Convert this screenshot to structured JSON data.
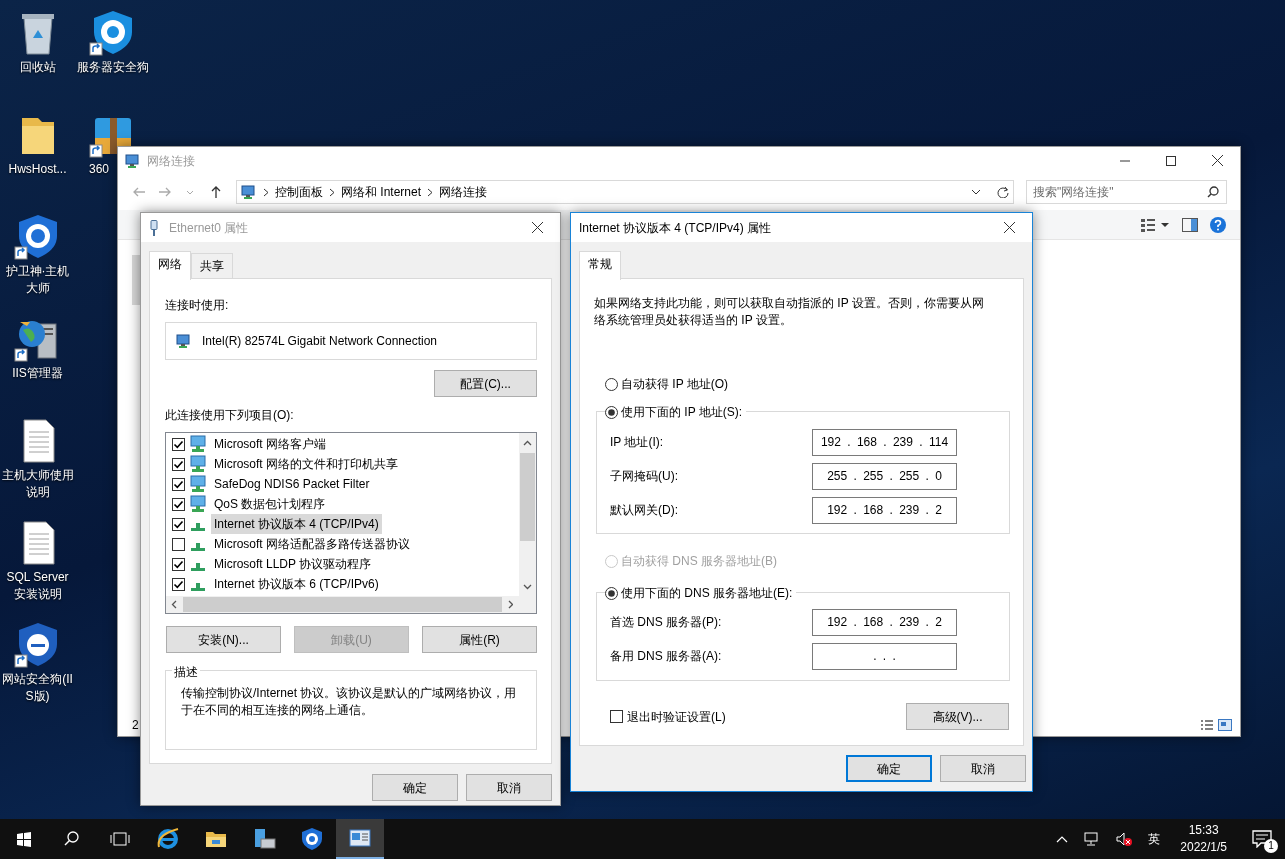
{
  "desktop_icons": [
    {
      "label": "回收站",
      "kind": "recycle",
      "shortcut": false
    },
    {
      "label": "HwsHost...",
      "kind": "folder",
      "shortcut": false
    },
    {
      "label": "护卫神·主机大师",
      "kind": "shield_w",
      "shortcut": true
    },
    {
      "label": "IIS管理器",
      "kind": "iis",
      "shortcut": true
    },
    {
      "label": "主机大师使用说明",
      "kind": "document",
      "shortcut": false
    },
    {
      "label": "SQL Server 安装说明",
      "kind": "document",
      "shortcut": false
    },
    {
      "label": "网站安全狗(IIS版)",
      "kind": "shield_e",
      "shortcut": true
    },
    {
      "label": "服务器安全狗",
      "kind": "shield_s",
      "shortcut": true
    },
    {
      "label": "360",
      "kind": "archive",
      "shortcut": true
    }
  ],
  "explorer": {
    "title": "网络连接",
    "path": [
      "控制面板",
      "网络和 Internet",
      "网络连接"
    ],
    "search": {
      "placeholder": "搜索\"网络连接\""
    },
    "status": "2"
  },
  "ethernet_dialog": {
    "title": "Ethernet0 属性",
    "active": false,
    "tabs": [
      {
        "label": "网络",
        "selected": true
      },
      {
        "label": "共享",
        "selected": false
      }
    ],
    "connect_using_label": "连接时使用:",
    "adapter": "Intel(R) 82574L Gigabit Network Connection",
    "configure_button": "配置(C)...",
    "items_label": "此连接使用下列项目(O):",
    "items": [
      {
        "label": "Microsoft 网络客户端",
        "kind": "client",
        "checked": true,
        "selected": false
      },
      {
        "label": "Microsoft 网络的文件和打印机共享",
        "kind": "client",
        "checked": true,
        "selected": false
      },
      {
        "label": "SafeDog NDIS6 Packet Filter",
        "kind": "client",
        "checked": true,
        "selected": false
      },
      {
        "label": "QoS 数据包计划程序",
        "kind": "client",
        "checked": true,
        "selected": false
      },
      {
        "label": "Internet 协议版本 4 (TCP/IPv4)",
        "kind": "protocol",
        "checked": true,
        "selected": true
      },
      {
        "label": "Microsoft 网络适配器多路传送器协议",
        "kind": "protocol",
        "checked": false,
        "selected": false
      },
      {
        "label": "Microsoft LLDP 协议驱动程序",
        "kind": "protocol",
        "checked": true,
        "selected": false
      },
      {
        "label": "Internet 协议版本 6 (TCP/IPv6)",
        "kind": "protocol",
        "checked": true,
        "selected": false
      }
    ],
    "actions": [
      {
        "label": "安装(N)...",
        "disabled": false
      },
      {
        "label": "卸载(U)",
        "disabled": true
      },
      {
        "label": "属性(R)",
        "disabled": false
      }
    ],
    "description_title": "描述",
    "description": "传输控制协议/Internet 协议。该协议是默认的广域网络协议，用于在不同的相互连接的网络上通信。",
    "footer_buttons": [
      {
        "label": "确定",
        "default": false
      },
      {
        "label": "取消",
        "default": false
      }
    ]
  },
  "ipv4_dialog": {
    "title": "Internet 协议版本 4 (TCP/IPv4) 属性",
    "active": true,
    "tabs": [
      {
        "label": "常规",
        "selected": true
      }
    ],
    "intro": "如果网络支持此功能，则可以获取自动指派的 IP 设置。否则，你需要从网络系统管理员处获得适当的 IP 设置。",
    "ip_options": [
      {
        "label": "自动获得 IP 地址(O)",
        "selected": false,
        "disabled": false
      },
      {
        "label": "使用下面的 IP 地址(S):",
        "selected": true,
        "disabled": false
      }
    ],
    "ip_fields": [
      {
        "label": "IP 地址(I):",
        "value": "192 . 168 . 239 . 114"
      },
      {
        "label": "子网掩码(U):",
        "value": "255 . 255 . 255 . 0"
      },
      {
        "label": "默认网关(D):",
        "value": "192 . 168 . 239 . 2"
      }
    ],
    "dns_options": [
      {
        "label": "自动获得 DNS 服务器地址(B)",
        "selected": false,
        "disabled": true
      },
      {
        "label": "使用下面的 DNS 服务器地址(E):",
        "selected": true,
        "disabled": false
      }
    ],
    "dns_fields": [
      {
        "label": "首选 DNS 服务器(P):",
        "value": "192 . 168 . 239 . 2"
      },
      {
        "label": "备用 DNS 服务器(A):",
        "value": ". . ."
      }
    ],
    "validate_on_exit": {
      "label": "退出时验证设置(L)",
      "checked": false
    },
    "advanced_button": "高级(V)...",
    "footer_buttons": [
      {
        "label": "确定",
        "default": true
      },
      {
        "label": "取消",
        "default": false
      }
    ]
  },
  "taskbar": {
    "apps": [
      {
        "kind": "start",
        "selected": false
      },
      {
        "kind": "search",
        "selected": false
      },
      {
        "kind": "taskview",
        "selected": false
      },
      {
        "kind": "browser",
        "selected": false
      },
      {
        "kind": "folder",
        "selected": false
      },
      {
        "kind": "server",
        "selected": false
      },
      {
        "kind": "shield",
        "selected": false
      },
      {
        "kind": "network",
        "selected": true
      }
    ],
    "tray": {
      "volume_muted": true,
      "ime": "英",
      "time": "15:33",
      "date": "2022/1/5",
      "notification_count": "1"
    }
  }
}
